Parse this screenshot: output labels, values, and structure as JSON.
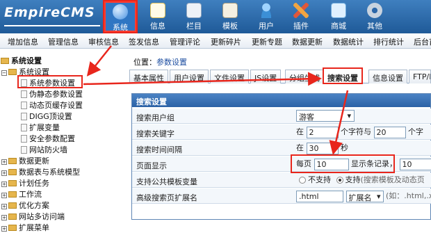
{
  "logo": "EmpireCMS",
  "nav": [
    {
      "label": "系统",
      "icon": "globe-icon",
      "color": "#7fb6f0",
      "active": true
    },
    {
      "label": "信息",
      "icon": "document-icon",
      "color": "#f2d07a"
    },
    {
      "label": "栏目",
      "icon": "column-icon",
      "color": "#cfd8e6"
    },
    {
      "label": "模板",
      "icon": "template-icon",
      "color": "#e8e0cc"
    },
    {
      "label": "用户",
      "icon": "user-icon",
      "color": "#7cc0f0"
    },
    {
      "label": "插件",
      "icon": "plugin-icon",
      "color": "#f0a542"
    },
    {
      "label": "商城",
      "icon": "shop-icon",
      "color": "#9fd0f5"
    },
    {
      "label": "其他",
      "icon": "gear-icon",
      "color": "#c8d3df"
    }
  ],
  "submenu": [
    "增加信息",
    "管理信息",
    "审核信息",
    "签发信息",
    "管理评论",
    "更新碎片",
    "更新专题",
    "数据更新",
    "数据统计",
    "排行统计",
    "后台首"
  ],
  "tree": {
    "root": "系统设置",
    "group": "系统设置",
    "items": [
      "系统参数设置",
      "伪静态参数设置",
      "动态页缓存设置",
      "DIGG顶设置",
      "扩展变量",
      "安全参数配置",
      "网站防火墙"
    ],
    "folders": [
      "数据更新",
      "数据表与系统模型",
      "计划任务",
      "工作流",
      "优化方案",
      "网站多访问端",
      "扩展菜单"
    ]
  },
  "breadcrumb": {
    "prefix": "位置：",
    "link": "参数设置"
  },
  "tabs": [
    "基本属性",
    "用户设置",
    "文件设置",
    "JS设置",
    "分组生成",
    "搜索设置",
    "信息设置",
    "FTP/E"
  ],
  "panel": {
    "title": "搜索设置",
    "rows": [
      {
        "label": "搜索用户组",
        "select": "游客"
      },
      {
        "label": "搜索关键字",
        "pre": "在",
        "v1": "2",
        "mid": "个字符与",
        "v2": "20",
        "post": "个字"
      },
      {
        "label": "搜索时间间隔",
        "pre": "在",
        "v1": "30",
        "post": "秒"
      },
      {
        "label": "页面显示",
        "pre": "每页",
        "v1": "10",
        "mid": "显示条记录",
        "v2": "10"
      },
      {
        "label": "支持公共模板变量",
        "opt1": "不支持",
        "opt2": "支持",
        "note": "(搜索模板及动态页"
      },
      {
        "label": "高级搜索页扩展名",
        "v1": ".html",
        "select": "扩展名",
        "note": "(如：.html,.x"
      }
    ]
  },
  "colors": {
    "highlight": "#e8261c",
    "header": "#2b62a6"
  }
}
